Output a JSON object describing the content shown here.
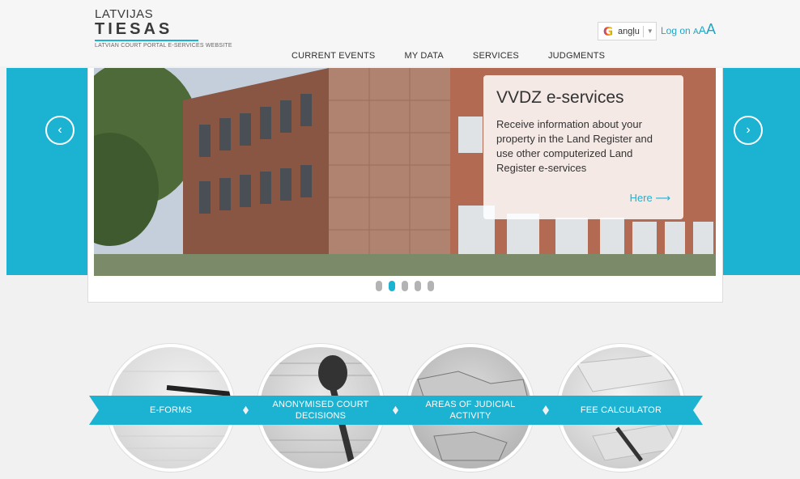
{
  "header": {
    "logo_line1": "LATVIJAS",
    "logo_line2": "TIESAS",
    "logo_sub": "LATVIAN COURT PORTAL E-SERVICES WEBSITE",
    "language_value": "angļu",
    "log_on_label": "Log on",
    "font_size_small": "A",
    "font_size_medium": "A",
    "font_size_large": "A"
  },
  "nav": {
    "items": [
      {
        "label": "CURRENT EVENTS"
      },
      {
        "label": "MY DATA"
      },
      {
        "label": "SERVICES"
      },
      {
        "label": "JUDGMENTS"
      }
    ]
  },
  "carousel": {
    "prev_icon": "chevron-left-icon",
    "next_icon": "chevron-right-icon",
    "slide": {
      "title": "VVDZ e-services",
      "text": "Receive information about your property in the Land Register and use other computerized Land Register e-services",
      "link_label": "Here ⟶"
    },
    "slide_count": 5,
    "active_slide": 2
  },
  "services": [
    {
      "label": "E-FORMS"
    },
    {
      "label": "ANONYMISED COURT DECISIONS"
    },
    {
      "label": "AREAS OF JUDICIAL ACTIVITY"
    },
    {
      "label": "FEE CALCULATOR"
    }
  ],
  "colors": {
    "accent": "#1cb3d3",
    "background": "#f1f1f1"
  }
}
